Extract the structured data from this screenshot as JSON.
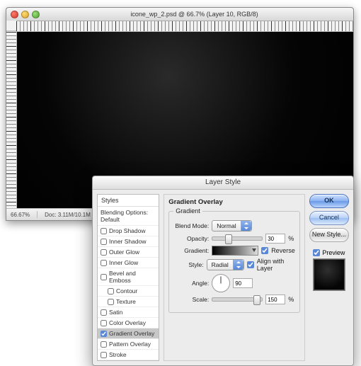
{
  "window": {
    "title": "icone_wp_2.psd @ 66.7% (Layer 10, RGB/8)"
  },
  "status": {
    "zoom": "66.67%",
    "docinfo": "Doc: 3.11M/10.1M"
  },
  "dialog": {
    "title": "Layer Style",
    "styles_label": "Styles",
    "blending_label": "Blending Options: Default",
    "rows": [
      {
        "label": "Drop Shadow",
        "checked": false
      },
      {
        "label": "Inner Shadow",
        "checked": false
      },
      {
        "label": "Outer Glow",
        "checked": false
      },
      {
        "label": "Inner Glow",
        "checked": false
      },
      {
        "label": "Bevel and Emboss",
        "checked": false
      },
      {
        "label": "Contour",
        "checked": false,
        "indent": true
      },
      {
        "label": "Texture",
        "checked": false,
        "indent": true
      },
      {
        "label": "Satin",
        "checked": false
      },
      {
        "label": "Color Overlay",
        "checked": false
      },
      {
        "label": "Gradient Overlay",
        "checked": true,
        "selected": true
      },
      {
        "label": "Pattern Overlay",
        "checked": false
      },
      {
        "label": "Stroke",
        "checked": false
      }
    ],
    "section": {
      "title": "Gradient Overlay",
      "group_label": "Gradient",
      "blend_mode_label": "Blend Mode:",
      "blend_mode_value": "Normal",
      "opacity_label": "Opacity:",
      "opacity_value": "30",
      "opacity_unit": "%",
      "gradient_label": "Gradient:",
      "reverse_label": "Reverse",
      "reverse_checked": true,
      "style_label": "Style:",
      "style_value": "Radial",
      "align_label": "Align with Layer",
      "align_checked": true,
      "angle_label": "Angle:",
      "angle_value": "90",
      "scale_label": "Scale:",
      "scale_value": "150",
      "scale_unit": "%"
    },
    "buttons": {
      "ok": "OK",
      "cancel": "Cancel",
      "newstyle": "New Style..."
    },
    "preview_label": "Preview",
    "preview_checked": true
  }
}
